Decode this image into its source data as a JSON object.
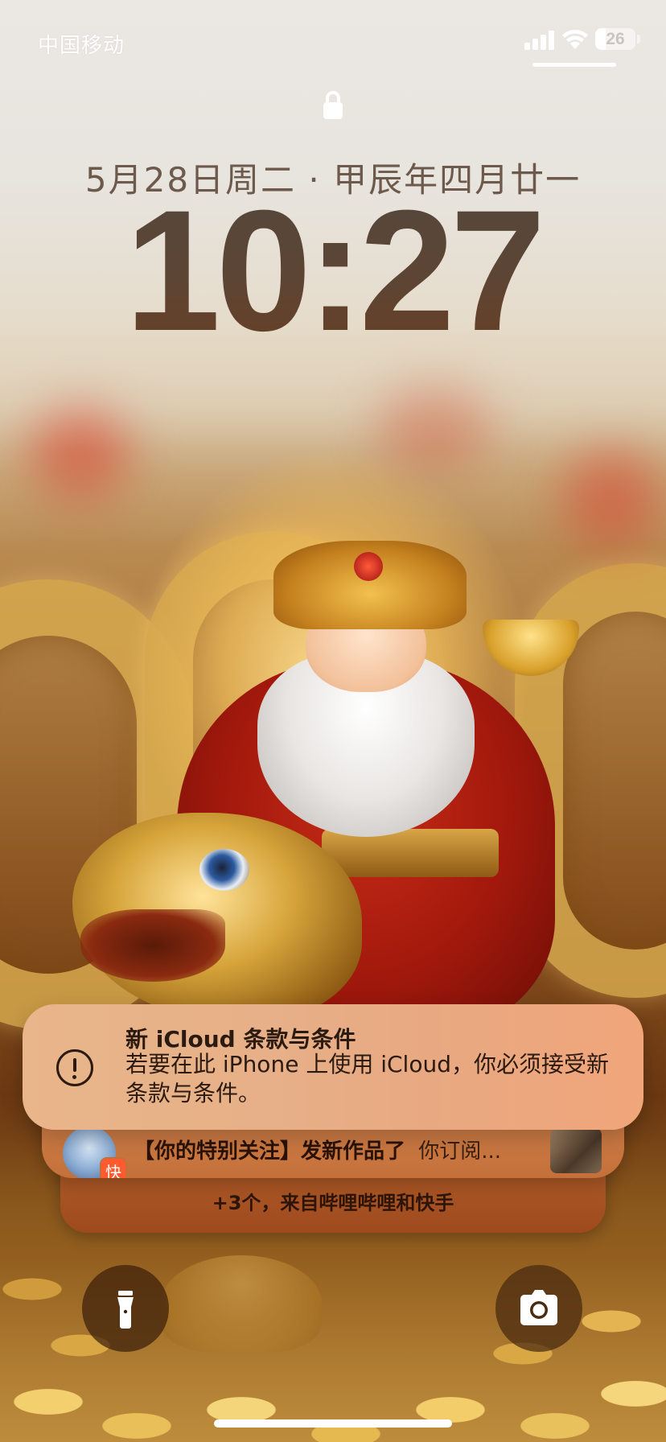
{
  "status_bar": {
    "carrier": "中国移动",
    "battery_level": "26",
    "battery_fraction": 0.26
  },
  "lock_screen": {
    "date": "5月28日周二 · 甲辰年四月廿一",
    "time": "10:27"
  },
  "notifications": {
    "primary": {
      "icon": "exclamation-circle-icon",
      "title": "新 iCloud 条款与条件",
      "body": "若要在此 iPhone 上使用 iCloud，你必须接受新条款与条件。"
    },
    "secondary": {
      "app_badge": "快",
      "title": "【你的特别关注】发新作品了",
      "body": "你订阅..."
    },
    "stack_summary": "+3个，来自哔哩哔哩和快手"
  },
  "quick_actions": {
    "left": "flashlight-icon",
    "right": "camera-icon"
  }
}
